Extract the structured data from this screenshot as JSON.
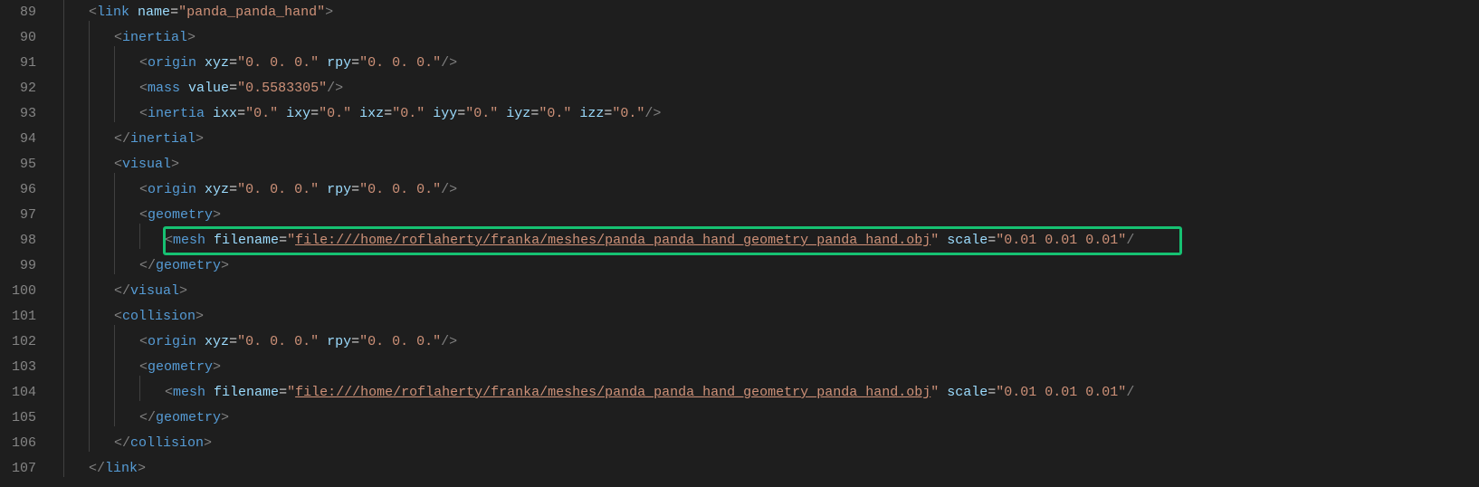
{
  "gutter": {
    "start": 89,
    "end": 107
  },
  "code": {
    "lines": [
      {
        "n": 89,
        "indent": 1,
        "tokens": [
          {
            "t": "bracket",
            "v": "<"
          },
          {
            "t": "tag",
            "v": "link"
          },
          {
            "t": "space",
            "v": " "
          },
          {
            "t": "attr",
            "v": "name"
          },
          {
            "t": "eq",
            "v": "="
          },
          {
            "t": "val",
            "v": "\"panda_panda_hand\""
          },
          {
            "t": "bracket",
            "v": ">"
          }
        ]
      },
      {
        "n": 90,
        "indent": 2,
        "tokens": [
          {
            "t": "bracket",
            "v": "<"
          },
          {
            "t": "tag",
            "v": "inertial"
          },
          {
            "t": "bracket",
            "v": ">"
          }
        ]
      },
      {
        "n": 91,
        "indent": 3,
        "tokens": [
          {
            "t": "bracket",
            "v": "<"
          },
          {
            "t": "tag",
            "v": "origin"
          },
          {
            "t": "space",
            "v": " "
          },
          {
            "t": "attr",
            "v": "xyz"
          },
          {
            "t": "eq",
            "v": "="
          },
          {
            "t": "val",
            "v": "\"0. 0. 0.\""
          },
          {
            "t": "space",
            "v": " "
          },
          {
            "t": "attr",
            "v": "rpy"
          },
          {
            "t": "eq",
            "v": "="
          },
          {
            "t": "val",
            "v": "\"0. 0. 0.\""
          },
          {
            "t": "bracket",
            "v": "/>"
          }
        ]
      },
      {
        "n": 92,
        "indent": 3,
        "tokens": [
          {
            "t": "bracket",
            "v": "<"
          },
          {
            "t": "tag",
            "v": "mass"
          },
          {
            "t": "space",
            "v": " "
          },
          {
            "t": "attr",
            "v": "value"
          },
          {
            "t": "eq",
            "v": "="
          },
          {
            "t": "val",
            "v": "\"0.5583305\""
          },
          {
            "t": "bracket",
            "v": "/>"
          }
        ]
      },
      {
        "n": 93,
        "indent": 3,
        "tokens": [
          {
            "t": "bracket",
            "v": "<"
          },
          {
            "t": "tag",
            "v": "inertia"
          },
          {
            "t": "space",
            "v": " "
          },
          {
            "t": "attr",
            "v": "ixx"
          },
          {
            "t": "eq",
            "v": "="
          },
          {
            "t": "val",
            "v": "\"0.\""
          },
          {
            "t": "space",
            "v": " "
          },
          {
            "t": "attr",
            "v": "ixy"
          },
          {
            "t": "eq",
            "v": "="
          },
          {
            "t": "val",
            "v": "\"0.\""
          },
          {
            "t": "space",
            "v": " "
          },
          {
            "t": "attr",
            "v": "ixz"
          },
          {
            "t": "eq",
            "v": "="
          },
          {
            "t": "val",
            "v": "\"0.\""
          },
          {
            "t": "space",
            "v": " "
          },
          {
            "t": "attr",
            "v": "iyy"
          },
          {
            "t": "eq",
            "v": "="
          },
          {
            "t": "val",
            "v": "\"0.\""
          },
          {
            "t": "space",
            "v": " "
          },
          {
            "t": "attr",
            "v": "iyz"
          },
          {
            "t": "eq",
            "v": "="
          },
          {
            "t": "val",
            "v": "\"0.\""
          },
          {
            "t": "space",
            "v": " "
          },
          {
            "t": "attr",
            "v": "izz"
          },
          {
            "t": "eq",
            "v": "="
          },
          {
            "t": "val",
            "v": "\"0.\""
          },
          {
            "t": "bracket",
            "v": "/>"
          }
        ]
      },
      {
        "n": 94,
        "indent": 2,
        "tokens": [
          {
            "t": "bracket",
            "v": "</"
          },
          {
            "t": "tag",
            "v": "inertial"
          },
          {
            "t": "bracket",
            "v": ">"
          }
        ]
      },
      {
        "n": 95,
        "indent": 2,
        "tokens": [
          {
            "t": "bracket",
            "v": "<"
          },
          {
            "t": "tag",
            "v": "visual"
          },
          {
            "t": "bracket",
            "v": ">"
          }
        ]
      },
      {
        "n": 96,
        "indent": 3,
        "tokens": [
          {
            "t": "bracket",
            "v": "<"
          },
          {
            "t": "tag",
            "v": "origin"
          },
          {
            "t": "space",
            "v": " "
          },
          {
            "t": "attr",
            "v": "xyz"
          },
          {
            "t": "eq",
            "v": "="
          },
          {
            "t": "val",
            "v": "\"0. 0. 0.\""
          },
          {
            "t": "space",
            "v": " "
          },
          {
            "t": "attr",
            "v": "rpy"
          },
          {
            "t": "eq",
            "v": "="
          },
          {
            "t": "val",
            "v": "\"0. 0. 0.\""
          },
          {
            "t": "bracket",
            "v": "/>"
          }
        ]
      },
      {
        "n": 97,
        "indent": 3,
        "tokens": [
          {
            "t": "bracket",
            "v": "<"
          },
          {
            "t": "tag",
            "v": "geometry"
          },
          {
            "t": "bracket",
            "v": ">"
          }
        ]
      },
      {
        "n": 98,
        "indent": 4,
        "highlighted": true,
        "tokens": [
          {
            "t": "bracket",
            "v": "<"
          },
          {
            "t": "tag",
            "v": "mesh"
          },
          {
            "t": "space",
            "v": " "
          },
          {
            "t": "attr",
            "v": "filename"
          },
          {
            "t": "eq",
            "v": "="
          },
          {
            "t": "val",
            "v": "\""
          },
          {
            "t": "link",
            "v": "file:///home/roflaherty/franka/meshes/panda_panda_hand_geometry_panda_hand.obj"
          },
          {
            "t": "val",
            "v": "\""
          },
          {
            "t": "space",
            "v": " "
          },
          {
            "t": "attr",
            "v": "scale"
          },
          {
            "t": "eq",
            "v": "="
          },
          {
            "t": "val",
            "v": "\"0.01 0.01 0.01\""
          },
          {
            "t": "bracket",
            "v": "/"
          }
        ]
      },
      {
        "n": 99,
        "indent": 3,
        "tokens": [
          {
            "t": "bracket",
            "v": "</"
          },
          {
            "t": "tag",
            "v": "geometry"
          },
          {
            "t": "bracket",
            "v": ">"
          }
        ]
      },
      {
        "n": 100,
        "indent": 2,
        "tokens": [
          {
            "t": "bracket",
            "v": "</"
          },
          {
            "t": "tag",
            "v": "visual"
          },
          {
            "t": "bracket",
            "v": ">"
          }
        ]
      },
      {
        "n": 101,
        "indent": 2,
        "tokens": [
          {
            "t": "bracket",
            "v": "<"
          },
          {
            "t": "tag",
            "v": "collision"
          },
          {
            "t": "bracket",
            "v": ">"
          }
        ]
      },
      {
        "n": 102,
        "indent": 3,
        "tokens": [
          {
            "t": "bracket",
            "v": "<"
          },
          {
            "t": "tag",
            "v": "origin"
          },
          {
            "t": "space",
            "v": " "
          },
          {
            "t": "attr",
            "v": "xyz"
          },
          {
            "t": "eq",
            "v": "="
          },
          {
            "t": "val",
            "v": "\"0. 0. 0.\""
          },
          {
            "t": "space",
            "v": " "
          },
          {
            "t": "attr",
            "v": "rpy"
          },
          {
            "t": "eq",
            "v": "="
          },
          {
            "t": "val",
            "v": "\"0. 0. 0.\""
          },
          {
            "t": "bracket",
            "v": "/>"
          }
        ]
      },
      {
        "n": 103,
        "indent": 3,
        "tokens": [
          {
            "t": "bracket",
            "v": "<"
          },
          {
            "t": "tag",
            "v": "geometry"
          },
          {
            "t": "bracket",
            "v": ">"
          }
        ]
      },
      {
        "n": 104,
        "indent": 4,
        "tokens": [
          {
            "t": "bracket",
            "v": "<"
          },
          {
            "t": "tag",
            "v": "mesh"
          },
          {
            "t": "space",
            "v": " "
          },
          {
            "t": "attr",
            "v": "filename"
          },
          {
            "t": "eq",
            "v": "="
          },
          {
            "t": "val",
            "v": "\""
          },
          {
            "t": "link",
            "v": "file:///home/roflaherty/franka/meshes/panda_panda_hand_geometry_panda_hand.obj"
          },
          {
            "t": "val",
            "v": "\""
          },
          {
            "t": "space",
            "v": " "
          },
          {
            "t": "attr",
            "v": "scale"
          },
          {
            "t": "eq",
            "v": "="
          },
          {
            "t": "val",
            "v": "\"0.01 0.01 0.01\""
          },
          {
            "t": "bracket",
            "v": "/"
          }
        ]
      },
      {
        "n": 105,
        "indent": 3,
        "tokens": [
          {
            "t": "bracket",
            "v": "</"
          },
          {
            "t": "tag",
            "v": "geometry"
          },
          {
            "t": "bracket",
            "v": ">"
          }
        ]
      },
      {
        "n": 106,
        "indent": 2,
        "tokens": [
          {
            "t": "bracket",
            "v": "</"
          },
          {
            "t": "tag",
            "v": "collision"
          },
          {
            "t": "bracket",
            "v": ">"
          }
        ]
      },
      {
        "n": 107,
        "indent": 1,
        "tokens": [
          {
            "t": "bracket",
            "v": "</"
          },
          {
            "t": "tag",
            "v": "link"
          },
          {
            "t": "bracket",
            "v": ">"
          }
        ]
      }
    ]
  }
}
